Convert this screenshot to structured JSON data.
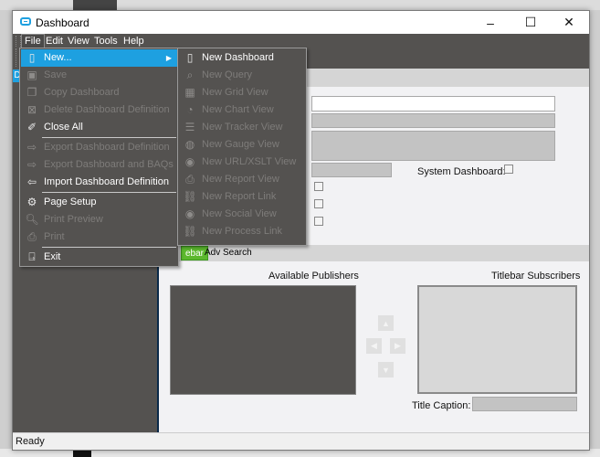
{
  "window": {
    "title": "Dashboard",
    "controls": {
      "minimize": "–",
      "maximize": "☐",
      "close": "✕"
    }
  },
  "menubar": {
    "items": [
      "File",
      "Edit",
      "View",
      "Tools",
      "Help"
    ],
    "active": "File"
  },
  "left_pane": {
    "tab_label": "D"
  },
  "file_menu": {
    "items": [
      {
        "label": "New...",
        "icon": "new-document-icon",
        "enabled": true,
        "highlighted": true,
        "submenu": true
      },
      {
        "label": "Save",
        "icon": "save-icon",
        "enabled": false
      },
      {
        "label": "Copy Dashboard",
        "icon": "copy-icon",
        "enabled": false
      },
      {
        "label": "Delete Dashboard Definition",
        "icon": "delete-icon",
        "enabled": false
      },
      {
        "label": "Close All",
        "icon": "broom-icon",
        "enabled": true
      },
      {
        "label": "Export Dashboard Definition",
        "icon": "export-icon",
        "enabled": false
      },
      {
        "label": "Export Dashboard and BAQs",
        "icon": "export-icon",
        "enabled": false
      },
      {
        "label": "Import Dashboard Definition",
        "icon": "import-icon",
        "enabled": true
      },
      {
        "label": "Page Setup",
        "icon": "page-setup-icon",
        "enabled": true
      },
      {
        "label": "Print Preview",
        "icon": "print-preview-icon",
        "enabled": false
      },
      {
        "label": "Print",
        "icon": "printer-icon",
        "enabled": false
      },
      {
        "label": "Exit",
        "icon": "exit-door-icon",
        "enabled": true
      }
    ]
  },
  "new_submenu": {
    "items": [
      {
        "label": "New Dashboard",
        "icon": "new-document-icon",
        "enabled": true
      },
      {
        "label": "New Query",
        "icon": "query-icon",
        "enabled": false
      },
      {
        "label": "New Grid View",
        "icon": "grid-icon",
        "enabled": false
      },
      {
        "label": "New Chart View",
        "icon": "pie-chart-icon",
        "enabled": false
      },
      {
        "label": "New Tracker View",
        "icon": "tracker-icon",
        "enabled": false
      },
      {
        "label": "New Gauge View",
        "icon": "gauge-icon",
        "enabled": false
      },
      {
        "label": "New URL/XSLT View",
        "icon": "globe-icon",
        "enabled": false
      },
      {
        "label": "New Report View",
        "icon": "printer-icon",
        "enabled": false
      },
      {
        "label": "New Report Link",
        "icon": "link-icon",
        "enabled": false
      },
      {
        "label": "New Social View",
        "icon": "globe-icon",
        "enabled": false
      },
      {
        "label": "New Process Link",
        "icon": "link-icon",
        "enabled": false
      }
    ]
  },
  "form": {
    "system_dashboard_label": "System Dashboard:",
    "system_dashboard_checked": false
  },
  "tabs": [
    {
      "label": "Titlebar",
      "visible_label": "ebar",
      "active": true
    },
    {
      "label": "Adv Search",
      "active": false
    }
  ],
  "titlebar_tab": {
    "available_publishers_label": "Available Publishers",
    "titlebar_subscribers_label": "Titlebar Subscribers",
    "title_caption_label": "Title Caption:",
    "title_caption_value": "",
    "arrows": {
      "up": "▲",
      "left": "◀",
      "right": "▶",
      "down": "▼"
    }
  },
  "status": {
    "text": "Ready"
  },
  "colors": {
    "accent": "#1ea0e0",
    "dark_panel": "#545250",
    "active_tab": "#5cb82e"
  }
}
